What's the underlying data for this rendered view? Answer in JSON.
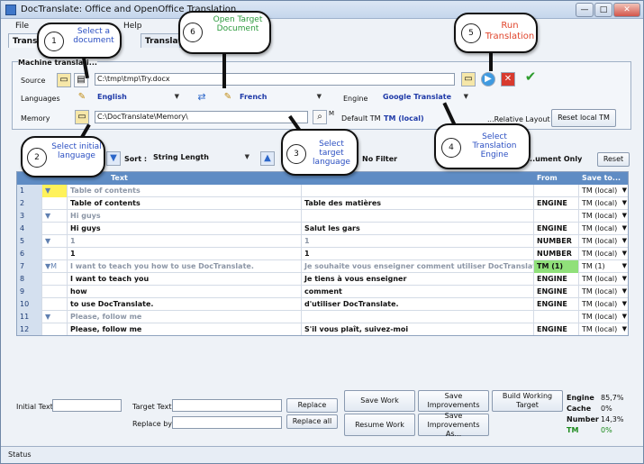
{
  "window": {
    "title": "DocTranslate: Office and OpenOffice Translation",
    "minimize": "—",
    "maximize": "□",
    "close": "✕"
  },
  "menu": {
    "file": "File",
    "help": "Help"
  },
  "tabs": {
    "translate": "Translat",
    "translator": "Translato"
  },
  "machine_group": {
    "label": "Machine translati..."
  },
  "source": {
    "label": "Source",
    "path": "C:\\tmp\\tmp\\Try.docx"
  },
  "languages": {
    "label": "Languages",
    "from": "English",
    "to": "French"
  },
  "engine": {
    "label": "Engine",
    "value": "Google Translate"
  },
  "memory": {
    "label": "Memory",
    "path": "C:\\DocTranslate\\Memory\\",
    "m_label": "M"
  },
  "default_tm": {
    "label": "Default TM",
    "value": "TM (local)"
  },
  "layout_label": "...Relative Layout",
  "reset_local_tm": "Reset local TM",
  "filter": {
    "sort_label": "Sort :",
    "sort_value": "String Length",
    "filter_value": "No Filter",
    "doc_only": "...ument Only",
    "reset": "Reset"
  },
  "grid": {
    "headers": {
      "text": "Text",
      "from": "From",
      "save_to": "Save to..."
    },
    "rows": [
      {
        "n": "1",
        "mark": "▼",
        "source": "Table of contents",
        "target": "",
        "from": "",
        "save": "TM (local)",
        "style": "grey"
      },
      {
        "n": "2",
        "mark": "",
        "source": "Table of contents",
        "target": "Table des matières",
        "from": "ENGINE",
        "save": "TM (local)",
        "style": "bold"
      },
      {
        "n": "3",
        "mark": "▼",
        "source": "Hi guys",
        "target": "",
        "from": "",
        "save": "TM (local)",
        "style": "grey"
      },
      {
        "n": "4",
        "mark": "",
        "source": "Hi guys",
        "target": "Salut les gars",
        "from": "ENGINE",
        "save": "TM (local)",
        "style": "bold"
      },
      {
        "n": "5",
        "mark": "▼",
        "source": "1",
        "target": "1",
        "from": "NUMBER",
        "save": "TM (local)",
        "style": "grey"
      },
      {
        "n": "6",
        "mark": "",
        "source": "1",
        "target": "1",
        "from": "NUMBER",
        "save": "TM (local)",
        "style": "bold"
      },
      {
        "n": "7",
        "mark": "▼M",
        "source": "I want to teach you how to use DocTranslate.",
        "target": "Je souhaite vous enseigner comment utiliser DocTranslate.",
        "from": "TM (1)",
        "save": "TM (1)",
        "style": "grey"
      },
      {
        "n": "8",
        "mark": "",
        "source": "I want to teach you",
        "target": "Je tiens à vous enseigner",
        "from": "ENGINE",
        "save": "TM (local)",
        "style": "bold"
      },
      {
        "n": "9",
        "mark": "",
        "source": "how",
        "target": "comment",
        "from": "ENGINE",
        "save": "TM (local)",
        "style": "bold"
      },
      {
        "n": "10",
        "mark": "",
        "source": " to use DocTranslate.",
        "target": "d'utiliser DocTranslate.",
        "from": "ENGINE",
        "save": "TM (local)",
        "style": "bold"
      },
      {
        "n": "11",
        "mark": "▼",
        "source": "Please, follow me",
        "target": "",
        "from": "",
        "save": "TM (local)",
        "style": "grey"
      },
      {
        "n": "12",
        "mark": "",
        "source": "Please, follow me",
        "target": "S'il vous plaît, suivez-moi",
        "from": "ENGINE",
        "save": "TM (local)",
        "style": "bold"
      }
    ]
  },
  "bottom": {
    "initial_text": "Initial Text",
    "target_text": "Target Text",
    "replace_by": "Replace by",
    "replace": "Replace",
    "replace_all": "Replace all",
    "save_work": "Save Work",
    "resume_work": "Resume Work",
    "save_improvements": "Save Improvements",
    "save_improvements_as": "Save Improvements As...",
    "build_target": "Build Working Target"
  },
  "stats": [
    {
      "label": "Engine",
      "value": "85,7%"
    },
    {
      "label": "Cache",
      "value": "0%"
    },
    {
      "label": "Number",
      "value": "14,3%"
    },
    {
      "label": "TM",
      "value": "0%"
    }
  ],
  "status": "Status",
  "callouts": [
    {
      "num": "1",
      "text": "Select a document",
      "color": "#2b4fc2"
    },
    {
      "num": "2",
      "text": "Select initial language",
      "color": "#2b4fc2"
    },
    {
      "num": "3",
      "text": "Select target language",
      "color": "#2b4fc2"
    },
    {
      "num": "4",
      "text": "Select Translation Engine",
      "color": "#2b4fc2"
    },
    {
      "num": "5",
      "text": "Run Translation",
      "color": "#e0452c"
    },
    {
      "num": "6",
      "text": "Open Target Document",
      "color": "#2b9a3c"
    }
  ],
  "colors": {
    "grid_header": "#5f8cc4",
    "tm_highlight": "#90e07a",
    "tm_text": "#1c8a1c"
  }
}
